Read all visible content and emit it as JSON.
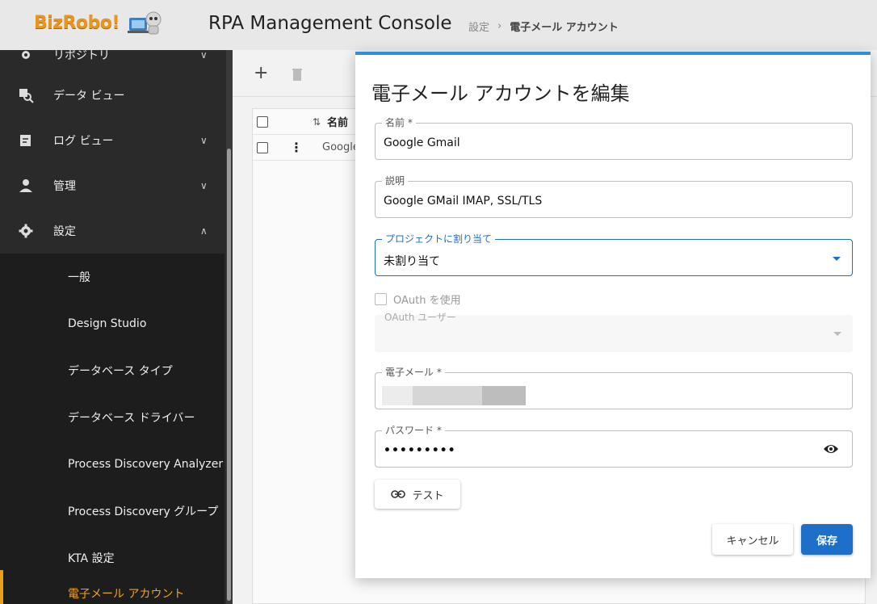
{
  "header": {
    "logo": "BizRobo!",
    "app_title": "RPA Management Console",
    "breadcrumb": [
      "設定",
      "電子メール アカウント"
    ]
  },
  "sidebar": {
    "items": [
      {
        "label": "リポジトリ",
        "icon": "gear-icon",
        "chevron": "chevron-down"
      },
      {
        "label": "データ ビュー",
        "icon": "data-view-icon",
        "chevron": ""
      },
      {
        "label": "ログ ビュー",
        "icon": "log-view-icon",
        "chevron": "chevron-down"
      },
      {
        "label": "管理",
        "icon": "user-icon",
        "chevron": "chevron-down"
      },
      {
        "label": "設定",
        "icon": "gear-icon",
        "chevron": "chevron-up"
      }
    ],
    "sub_items": [
      {
        "label": "一般"
      },
      {
        "label": "Design Studio"
      },
      {
        "label": "データベース タイプ"
      },
      {
        "label": "データベース ドライバー"
      },
      {
        "label": "Process Discovery Analyzer"
      },
      {
        "label": "Process Discovery グループ"
      },
      {
        "label": "KTA 設定"
      },
      {
        "label": "電子メール アカウント",
        "active": true
      }
    ]
  },
  "grid": {
    "header_col": "名前",
    "rows": [
      {
        "name": "Google Gmail"
      }
    ]
  },
  "modal": {
    "title": "電子メール アカウントを編集",
    "fields": {
      "name": {
        "label": "名前 *",
        "value": "Google Gmail"
      },
      "description": {
        "label": "説明",
        "value": "Google GMail IMAP, SSL/TLS"
      },
      "project": {
        "label": "プロジェクトに割り当て",
        "value": "未割り当て"
      },
      "use_oauth": {
        "label": "OAuth を使用",
        "checked": false
      },
      "oauth_user": {
        "label": "OAuth ユーザー",
        "value": ""
      },
      "email": {
        "label": "電子メール *",
        "value": ""
      },
      "password": {
        "label": "パスワード *",
        "value": "•••••••••"
      }
    },
    "buttons": {
      "test": "テスト",
      "cancel": "キャンセル",
      "save": "保存"
    }
  },
  "colors": {
    "accent": "#1e6fc7",
    "sidebar_bg": "#2a2a2a",
    "active_item": "#f0a21c",
    "logo": "#e8961e"
  }
}
